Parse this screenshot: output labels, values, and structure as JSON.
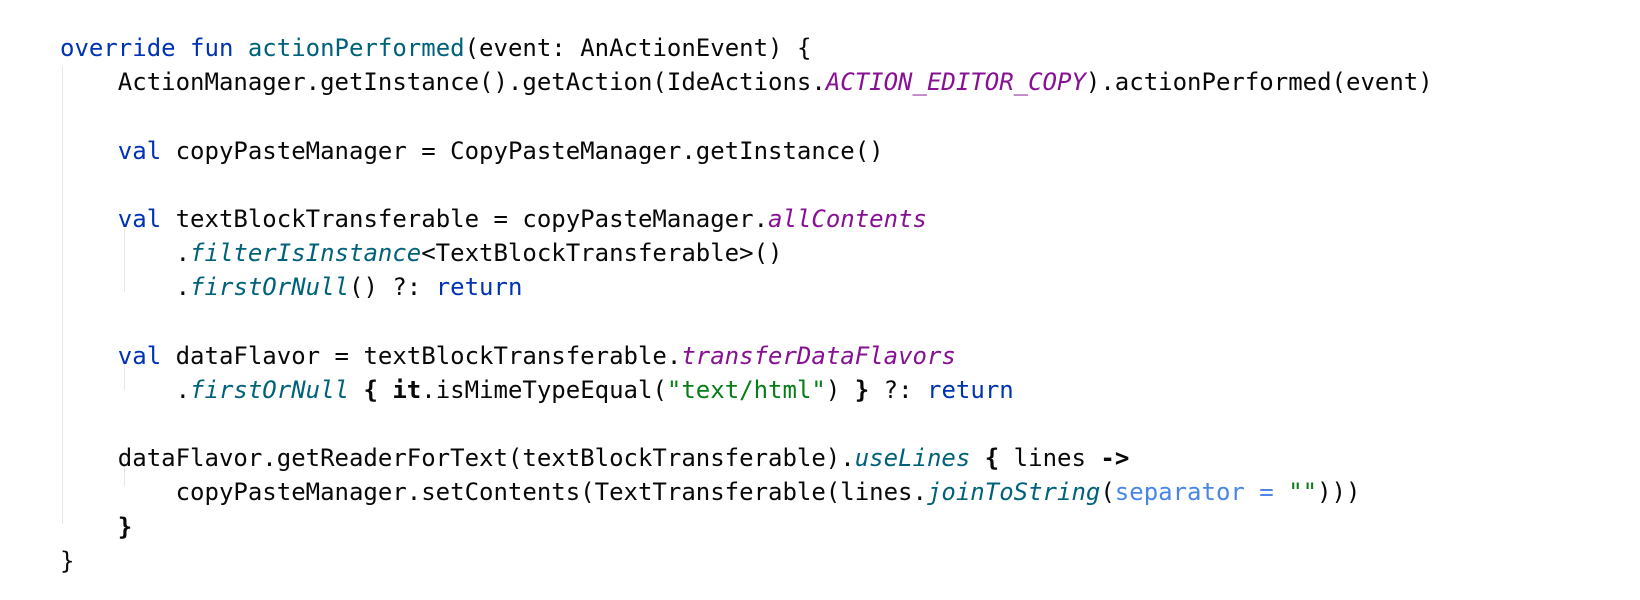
{
  "editor": {
    "lines": [
      {
        "segments": [
          {
            "text": "override",
            "kind": "kw"
          },
          {
            "text": " ",
            "kind": "plain"
          },
          {
            "text": "fun",
            "kind": "kw"
          },
          {
            "text": " ",
            "kind": "plain"
          },
          {
            "text": "actionPerformed",
            "kind": "fn"
          },
          {
            "text": "(event: AnActionEvent) {",
            "kind": "plain"
          }
        ]
      },
      {
        "segments": [
          {
            "text": "    ActionManager.getInstance().getAction(IdeActions.",
            "kind": "plain"
          },
          {
            "text": "ACTION_EDITOR_COPY",
            "kind": "field-static"
          },
          {
            "text": ").actionPerformed(event)",
            "kind": "plain"
          }
        ]
      },
      {
        "segments": [
          {
            "text": "",
            "kind": "plain"
          }
        ]
      },
      {
        "segments": [
          {
            "text": "    ",
            "kind": "plain"
          },
          {
            "text": "val",
            "kind": "kw"
          },
          {
            "text": " copyPasteManager = CopyPasteManager.getInstance()",
            "kind": "plain"
          }
        ]
      },
      {
        "segments": [
          {
            "text": "",
            "kind": "plain"
          }
        ]
      },
      {
        "segments": [
          {
            "text": "    ",
            "kind": "plain"
          },
          {
            "text": "val",
            "kind": "kw"
          },
          {
            "text": " textBlockTransferable = copyPasteManager.",
            "kind": "plain"
          },
          {
            "text": "allContents",
            "kind": "prop"
          }
        ]
      },
      {
        "segments": [
          {
            "text": "        .",
            "kind": "plain"
          },
          {
            "text": "filterIsInstance",
            "kind": "ext"
          },
          {
            "text": "<TextBlockTransferable>()",
            "kind": "plain"
          }
        ]
      },
      {
        "segments": [
          {
            "text": "        .",
            "kind": "plain"
          },
          {
            "text": "firstOrNull",
            "kind": "ext"
          },
          {
            "text": "() ?: ",
            "kind": "plain"
          },
          {
            "text": "return",
            "kind": "kw"
          }
        ]
      },
      {
        "segments": [
          {
            "text": "",
            "kind": "plain"
          }
        ]
      },
      {
        "segments": [
          {
            "text": "    ",
            "kind": "plain"
          },
          {
            "text": "val",
            "kind": "kw"
          },
          {
            "text": " dataFlavor = textBlockTransferable.",
            "kind": "plain"
          },
          {
            "text": "transferDataFlavors",
            "kind": "prop"
          }
        ]
      },
      {
        "segments": [
          {
            "text": "        .",
            "kind": "plain"
          },
          {
            "text": "firstOrNull",
            "kind": "ext"
          },
          {
            "text": " ",
            "kind": "plain"
          },
          {
            "text": "{",
            "kind": "bold"
          },
          {
            "text": " ",
            "kind": "plain"
          },
          {
            "text": "it",
            "kind": "bold"
          },
          {
            "text": ".isMimeTypeEqual(",
            "kind": "plain"
          },
          {
            "text": "\"text/html\"",
            "kind": "str"
          },
          {
            "text": ") ",
            "kind": "plain"
          },
          {
            "text": "}",
            "kind": "bold"
          },
          {
            "text": " ?: ",
            "kind": "plain"
          },
          {
            "text": "return",
            "kind": "kw"
          }
        ]
      },
      {
        "segments": [
          {
            "text": "",
            "kind": "plain"
          }
        ]
      },
      {
        "segments": [
          {
            "text": "    dataFlavor.getReaderForText(textBlockTransferable).",
            "kind": "plain"
          },
          {
            "text": "useLines",
            "kind": "ext"
          },
          {
            "text": " ",
            "kind": "plain"
          },
          {
            "text": "{",
            "kind": "bold"
          },
          {
            "text": " lines ",
            "kind": "plain"
          },
          {
            "text": "->",
            "kind": "bold"
          }
        ]
      },
      {
        "segments": [
          {
            "text": "        copyPasteManager.setContents(TextTransferable(lines.",
            "kind": "plain"
          },
          {
            "text": "joinToString",
            "kind": "ext"
          },
          {
            "text": "(",
            "kind": "plain"
          },
          {
            "text": "separator = ",
            "kind": "named"
          },
          {
            "text": "\"\"",
            "kind": "str"
          },
          {
            "text": ")))",
            "kind": "plain"
          }
        ]
      },
      {
        "segments": [
          {
            "text": "    ",
            "kind": "plain"
          },
          {
            "text": "}",
            "kind": "bold"
          }
        ]
      },
      {
        "segments": [
          {
            "text": "}",
            "kind": "plain"
          }
        ]
      }
    ]
  }
}
